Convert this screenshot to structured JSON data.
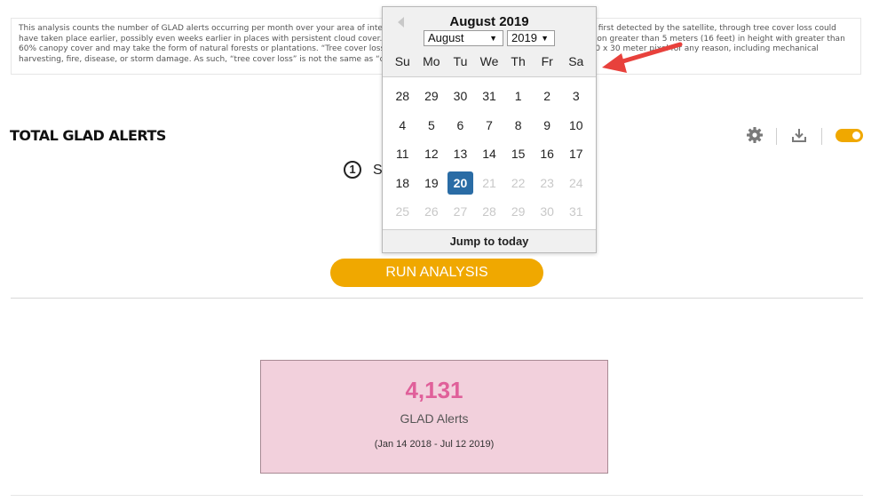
{
  "description": "This analysis counts the number of GLAD alerts occurring per month over your area of interest. GLAD alerts indicate the date on which loss was first detected by the satellite, through tree cover loss could have taken place earlier, possibly even weeks earlier in places with persistent cloud cover. In this dataset, “tree cover” is defined as all vegetation greater than 5 meters (16 feet) in height with greater than 60% canopy cover and may take the form of natural forests or plantations. “Tree cover loss” indicates the canopy removal of at least half of a 30 x 30 meter pixel for any reason, including mechanical harvesting, fire, disease, or storm damage. As such, “tree cover loss” is not the same as “deforestation”.",
  "widget": {
    "title": "TOTAL GLAD ALERTS",
    "toolbar": {
      "settings_icon": "gear-icon",
      "download_icon": "download-icon",
      "toggle_state": "on"
    }
  },
  "step": {
    "number": "1",
    "label": "S"
  },
  "run_button": {
    "label": "RUN ANALYSIS"
  },
  "stat": {
    "value": "4,131",
    "label": "GLAD Alerts",
    "range": "(Jan 14 2018 - Jul 12 2019)"
  },
  "datepicker": {
    "title": "August 2019",
    "month_select": "August",
    "year_select": "2019",
    "weekdays": [
      "Su",
      "Mo",
      "Tu",
      "We",
      "Th",
      "Fr",
      "Sa"
    ],
    "weeks": [
      [
        {
          "d": "28"
        },
        {
          "d": "29"
        },
        {
          "d": "30"
        },
        {
          "d": "31"
        },
        {
          "d": "1"
        },
        {
          "d": "2"
        },
        {
          "d": "3"
        }
      ],
      [
        {
          "d": "4"
        },
        {
          "d": "5"
        },
        {
          "d": "6"
        },
        {
          "d": "7"
        },
        {
          "d": "8"
        },
        {
          "d": "9"
        },
        {
          "d": "10"
        }
      ],
      [
        {
          "d": "11"
        },
        {
          "d": "12"
        },
        {
          "d": "13"
        },
        {
          "d": "14"
        },
        {
          "d": "15"
        },
        {
          "d": "16"
        },
        {
          "d": "17"
        }
      ],
      [
        {
          "d": "18"
        },
        {
          "d": "19"
        },
        {
          "d": "20",
          "selected": true
        },
        {
          "d": "21",
          "disabled": true
        },
        {
          "d": "22",
          "disabled": true
        },
        {
          "d": "23",
          "disabled": true
        },
        {
          "d": "24",
          "disabled": true
        }
      ],
      [
        {
          "d": "25",
          "disabled": true
        },
        {
          "d": "26",
          "disabled": true
        },
        {
          "d": "27",
          "disabled": true
        },
        {
          "d": "28",
          "disabled": true
        },
        {
          "d": "29",
          "disabled": true
        },
        {
          "d": "30",
          "disabled": true
        },
        {
          "d": "31",
          "disabled": true
        }
      ]
    ],
    "footer": "Jump to today"
  },
  "colors": {
    "accent": "#f0a800",
    "selected_day": "#2a6ca5",
    "stat_value": "#e0609a",
    "stat_bg": "#f2d0dc",
    "arrow": "#e8413c"
  }
}
